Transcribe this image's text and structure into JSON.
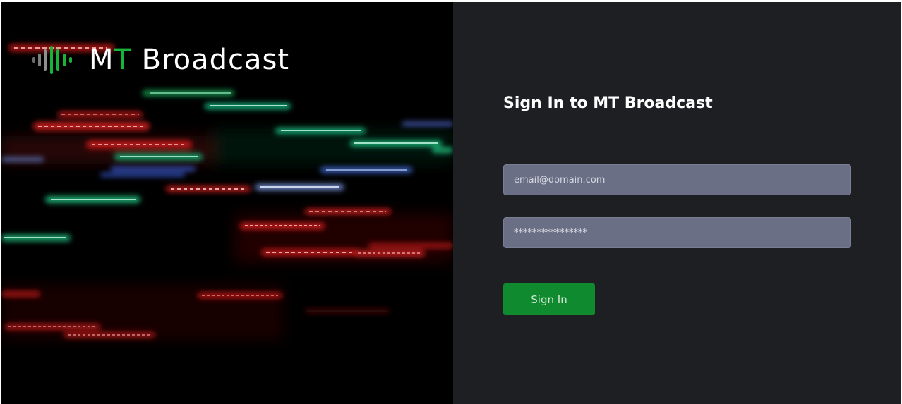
{
  "brand": {
    "logo_prefix": "M",
    "logo_accent": "T",
    "logo_suffix": " Broadcast",
    "accent_color": "#16b53a"
  },
  "form": {
    "title": "Sign In to MT Broadcast",
    "email": {
      "placeholder": "email@domain.com",
      "value": ""
    },
    "password": {
      "value": "****************"
    },
    "submit_label": "Sign In"
  },
  "colors": {
    "left_background": "#000000",
    "right_background": "#1e1f23",
    "input_background": "#6b6f85",
    "button_background": "#0f8a2f"
  }
}
